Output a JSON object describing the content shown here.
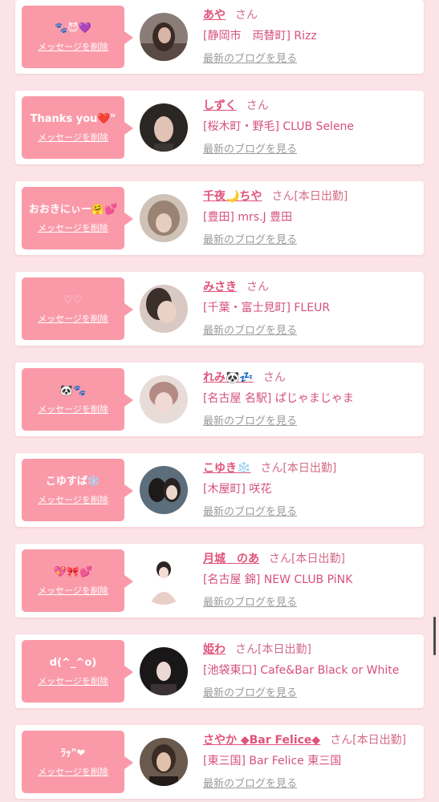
{
  "common": {
    "delete_label": "メッセージを削除",
    "blog_label": "最新のブログを見る"
  },
  "cards": [
    {
      "message": "🐾😈💜",
      "name": "あや",
      "suffix": "さん",
      "shop": "[静岡市　両替町] Rizz"
    },
    {
      "message": "Thanks you❤️\"",
      "name": "しずく",
      "suffix": "さん",
      "shop": "[桜木町・野毛] CLUB Selene"
    },
    {
      "message": "おおきにぃー🤗💕",
      "name": "千夜🌙ちや",
      "suffix": "さん[本日出勤]",
      "shop": "[豊田] mrs.J 豊田"
    },
    {
      "message": "♡♡",
      "name": "みさき",
      "suffix": "さん",
      "shop": "[千葉・富士見町] FLEUR"
    },
    {
      "message": "🐼🐾",
      "name": "れみ🐼💤",
      "suffix": "さん",
      "shop": "[名古屋 名駅] ぱじゃまじゃま"
    },
    {
      "message": "こゆすば❄️",
      "name": "こゆき❄️",
      "suffix": "さん[本日出勤]",
      "shop": "[木屋町] 咲花"
    },
    {
      "message": "💖🎀💕",
      "name": "月城　のあ",
      "suffix": "さん[本日出勤]",
      "shop": "[名古屋 錦] NEW CLUB PiNK"
    },
    {
      "message": "d(^_^o)",
      "name": "姫わ",
      "suffix": "さん[本日出勤]",
      "shop": "[池袋東口] Cafe&Bar Black or White"
    },
    {
      "message": "ﾗｯ\"❤",
      "name": "さやか ◆Bar Felice◆",
      "suffix": "さん[本日出勤]",
      "shop": "[東三国] Bar Felice 東三国"
    }
  ]
}
